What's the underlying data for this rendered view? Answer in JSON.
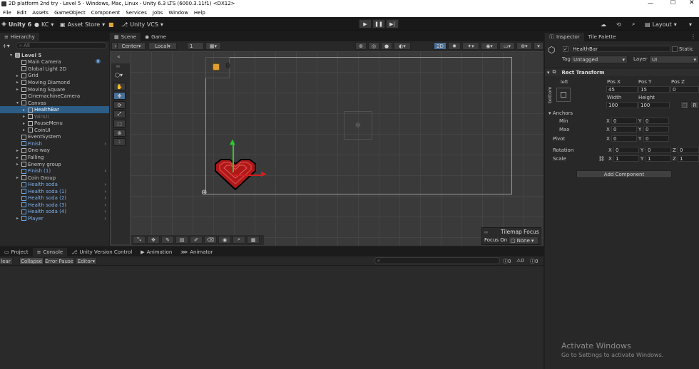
{
  "title": "2D platform 2nd try - Level 5 - Windows, Mac, Linux - Unity 6.3 LTS (6000.3.11f1) <DX12>",
  "menu": [
    "File",
    "Edit",
    "Assets",
    "GameObject",
    "Component",
    "Services",
    "Jobs",
    "Window",
    "Help"
  ],
  "toolbar": {
    "unity": "Unity 6",
    "account": "KC",
    "asset_store": "Asset Store",
    "vcs": "Unity VCS",
    "layout": "Layout"
  },
  "hierarchy": {
    "tab": "Hierarchy",
    "search_placeholder": "All",
    "items": [
      {
        "label": "Level 5",
        "indent": 0,
        "type": "scene",
        "expanded": true
      },
      {
        "label": "Main Camera",
        "indent": 1,
        "type": "obj"
      },
      {
        "label": "Global Light 2D",
        "indent": 1,
        "type": "obj"
      },
      {
        "label": "Grid",
        "indent": 1,
        "type": "obj",
        "arrow": true
      },
      {
        "label": "Moving Diamond",
        "indent": 1,
        "type": "obj",
        "arrow": true
      },
      {
        "label": "Moving Square",
        "indent": 1,
        "type": "obj",
        "arrow": true
      },
      {
        "label": "CinemachineCamera",
        "indent": 1,
        "type": "obj"
      },
      {
        "label": "Canvas",
        "indent": 1,
        "type": "obj",
        "expanded": true
      },
      {
        "label": "HealthBar",
        "indent": 2,
        "type": "obj",
        "arrow": true,
        "selected": true
      },
      {
        "label": "WinUI",
        "indent": 2,
        "type": "obj",
        "arrow": true,
        "dim": true
      },
      {
        "label": "PauseMenu",
        "indent": 2,
        "type": "obj",
        "arrow": true
      },
      {
        "label": "CoinUI",
        "indent": 2,
        "type": "obj",
        "arrow": true
      },
      {
        "label": "EventSystem",
        "indent": 1,
        "type": "obj"
      },
      {
        "label": "Finish",
        "indent": 1,
        "type": "prefab",
        "child": true
      },
      {
        "label": "One-way",
        "indent": 1,
        "type": "obj",
        "arrow": true
      },
      {
        "label": "Falling",
        "indent": 1,
        "type": "obj",
        "arrow": true
      },
      {
        "label": "Enemy group",
        "indent": 1,
        "type": "obj",
        "arrow": true
      },
      {
        "label": "Finish (1)",
        "indent": 1,
        "type": "prefab",
        "child": true
      },
      {
        "label": "Coin Group",
        "indent": 1,
        "type": "obj",
        "arrow": true
      },
      {
        "label": "Health soda",
        "indent": 1,
        "type": "prefab",
        "child": true
      },
      {
        "label": "Health soda (1)",
        "indent": 1,
        "type": "prefab",
        "child": true
      },
      {
        "label": "Health soda (2)",
        "indent": 1,
        "type": "prefab",
        "child": true
      },
      {
        "label": "Health soda (3)",
        "indent": 1,
        "type": "prefab",
        "child": true
      },
      {
        "label": "Health soda (4)",
        "indent": 1,
        "type": "prefab",
        "child": true
      },
      {
        "label": "Player",
        "indent": 1,
        "type": "prefab",
        "arrow": true,
        "child": true
      }
    ]
  },
  "scene": {
    "tabs": [
      "Scene",
      "Game"
    ],
    "pivot": "Center",
    "space": "Local",
    "snap": "1",
    "mode_2d": "2D",
    "coin_count": "0",
    "tilemap_focus": "Tilemap Focus",
    "focus_on_label": "Focus On",
    "focus_on_value": "None"
  },
  "console": {
    "tabs": [
      "Project",
      "Console",
      "Unity Version Control",
      "Animation",
      "Animator"
    ],
    "buttons": [
      "lear",
      "Collapse",
      "Error Pause",
      "Editor"
    ],
    "counts": [
      "0",
      "0",
      "0"
    ]
  },
  "inspector": {
    "tabs": [
      "Inspector",
      "Tile Palette"
    ],
    "name": "HealthBar",
    "static": "Static",
    "tag_label": "Tag",
    "tag": "Untagged",
    "layer_label": "Layer",
    "layer": "UI",
    "component": "Rect Transform",
    "anchor_left": "left",
    "anchor_bottom": "bottom",
    "pos_x_label": "Pos X",
    "pos_y_label": "Pos Y",
    "pos_z_label": "Pos Z",
    "pos_x": "45",
    "pos_y": "15",
    "pos_z": "0",
    "width_label": "Width",
    "height_label": "Height",
    "width": "100",
    "height": "100",
    "anchors": "Anchors",
    "min": "Min",
    "max": "Max",
    "pivot": "Pivot",
    "rotation": "Rotation",
    "scale": "Scale",
    "min_x": "0",
    "min_y": "0",
    "max_x": "0",
    "max_y": "0",
    "pivot_x": "0",
    "pivot_y": "0",
    "rot_x": "0",
    "rot_y": "0",
    "rot_z": "0",
    "scale_x": "1",
    "scale_y": "1",
    "scale_z": "1",
    "add_component": "Add Component",
    "activate_title": "Activate Windows",
    "activate_sub": "Go to Settings to activate Windows."
  }
}
